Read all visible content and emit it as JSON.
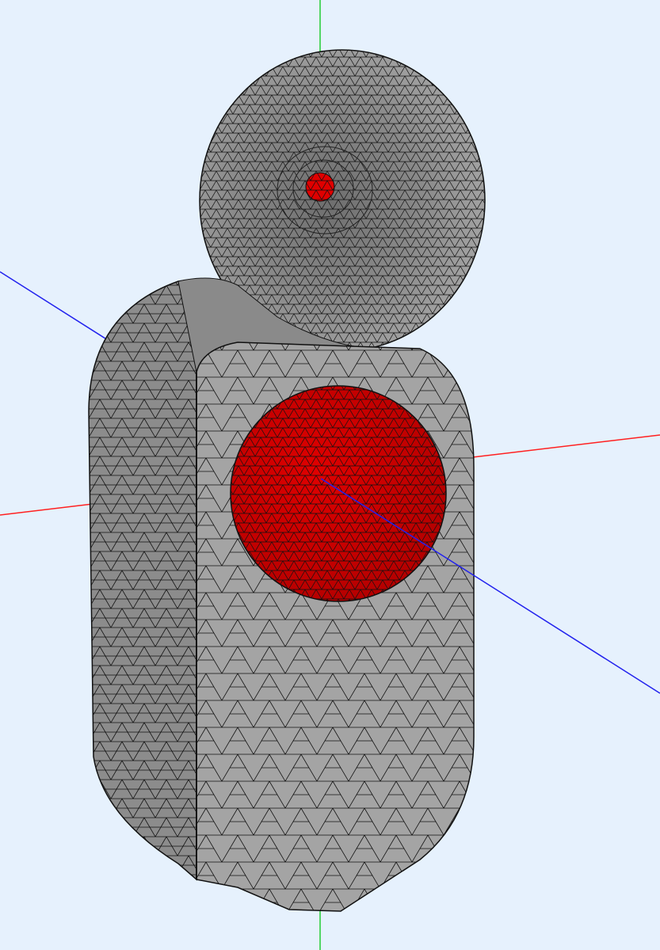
{
  "viewport": {
    "background": "#e6f1fd"
  },
  "axes": [
    {
      "name": "x",
      "color": "#ff2020"
    },
    {
      "name": "y",
      "color": "#22cc33"
    },
    {
      "name": "z",
      "color": "#2222ee"
    }
  ],
  "mesh": {
    "surface_color": "#9c9c9c",
    "shadow_color": "#7f7f7f",
    "edge_color": "#111111",
    "highlight_color": "#e00000",
    "parts": [
      {
        "name": "torus-ring",
        "style": "surface"
      },
      {
        "name": "ring-inner-boundary",
        "style": "highlight"
      },
      {
        "name": "rounded-block",
        "style": "surface"
      },
      {
        "name": "sphere-cutout",
        "style": "highlight"
      }
    ]
  }
}
